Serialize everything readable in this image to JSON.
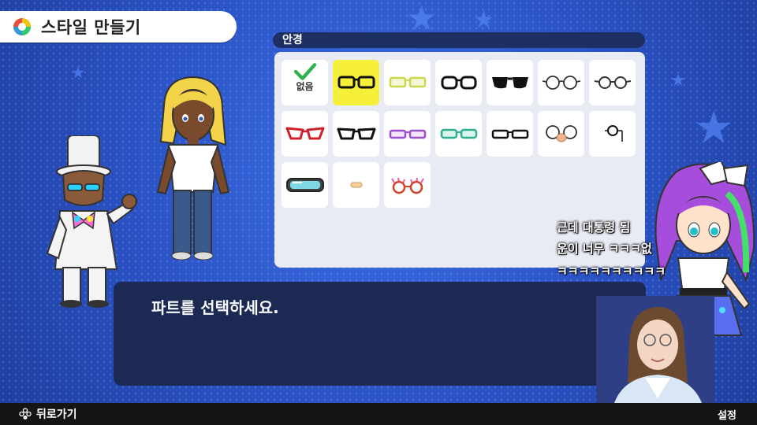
{
  "screen": {
    "title": "스타일 만들기",
    "title_icon": "color-wheel-icon"
  },
  "glasses_panel": {
    "heading": "안경",
    "none_label": "없음",
    "items": [
      {
        "name": "none",
        "selected": false,
        "checked": true
      },
      {
        "name": "black-rectangle-glasses",
        "selected": true
      },
      {
        "name": "yellow-rectangle-glasses"
      },
      {
        "name": "black-round-rectangle-glasses"
      },
      {
        "name": "black-sunglasses"
      },
      {
        "name": "thin-round-glasses"
      },
      {
        "name": "thin-round-glasses-2"
      },
      {
        "name": "red-cat-eye-glasses"
      },
      {
        "name": "black-cat-eye-glasses"
      },
      {
        "name": "purple-glasses"
      },
      {
        "name": "teal-glasses"
      },
      {
        "name": "black-narrow-glasses"
      },
      {
        "name": "nose-glasses"
      },
      {
        "name": "monocle"
      },
      {
        "name": "ski-goggles"
      },
      {
        "name": "small-bandage"
      },
      {
        "name": "party-glasses"
      }
    ]
  },
  "dialog": {
    "message": "파트를 선택하세요."
  },
  "chat_overlay": {
    "lines": [
      "근데 대통령 됨",
      "운이 너무 ㅋㅋㅋ없",
      "ㅋㅋㅋㅋㅋㅋㅋㅋㅋㅋ"
    ]
  },
  "bottom_bar": {
    "back_label": "뒤로가기",
    "settings_label": "설정"
  },
  "colors": {
    "background": "#2b56c9",
    "panel_header": "#1e2f63",
    "selected_tile": "#f6f03a",
    "dialog": "#1c2850"
  }
}
